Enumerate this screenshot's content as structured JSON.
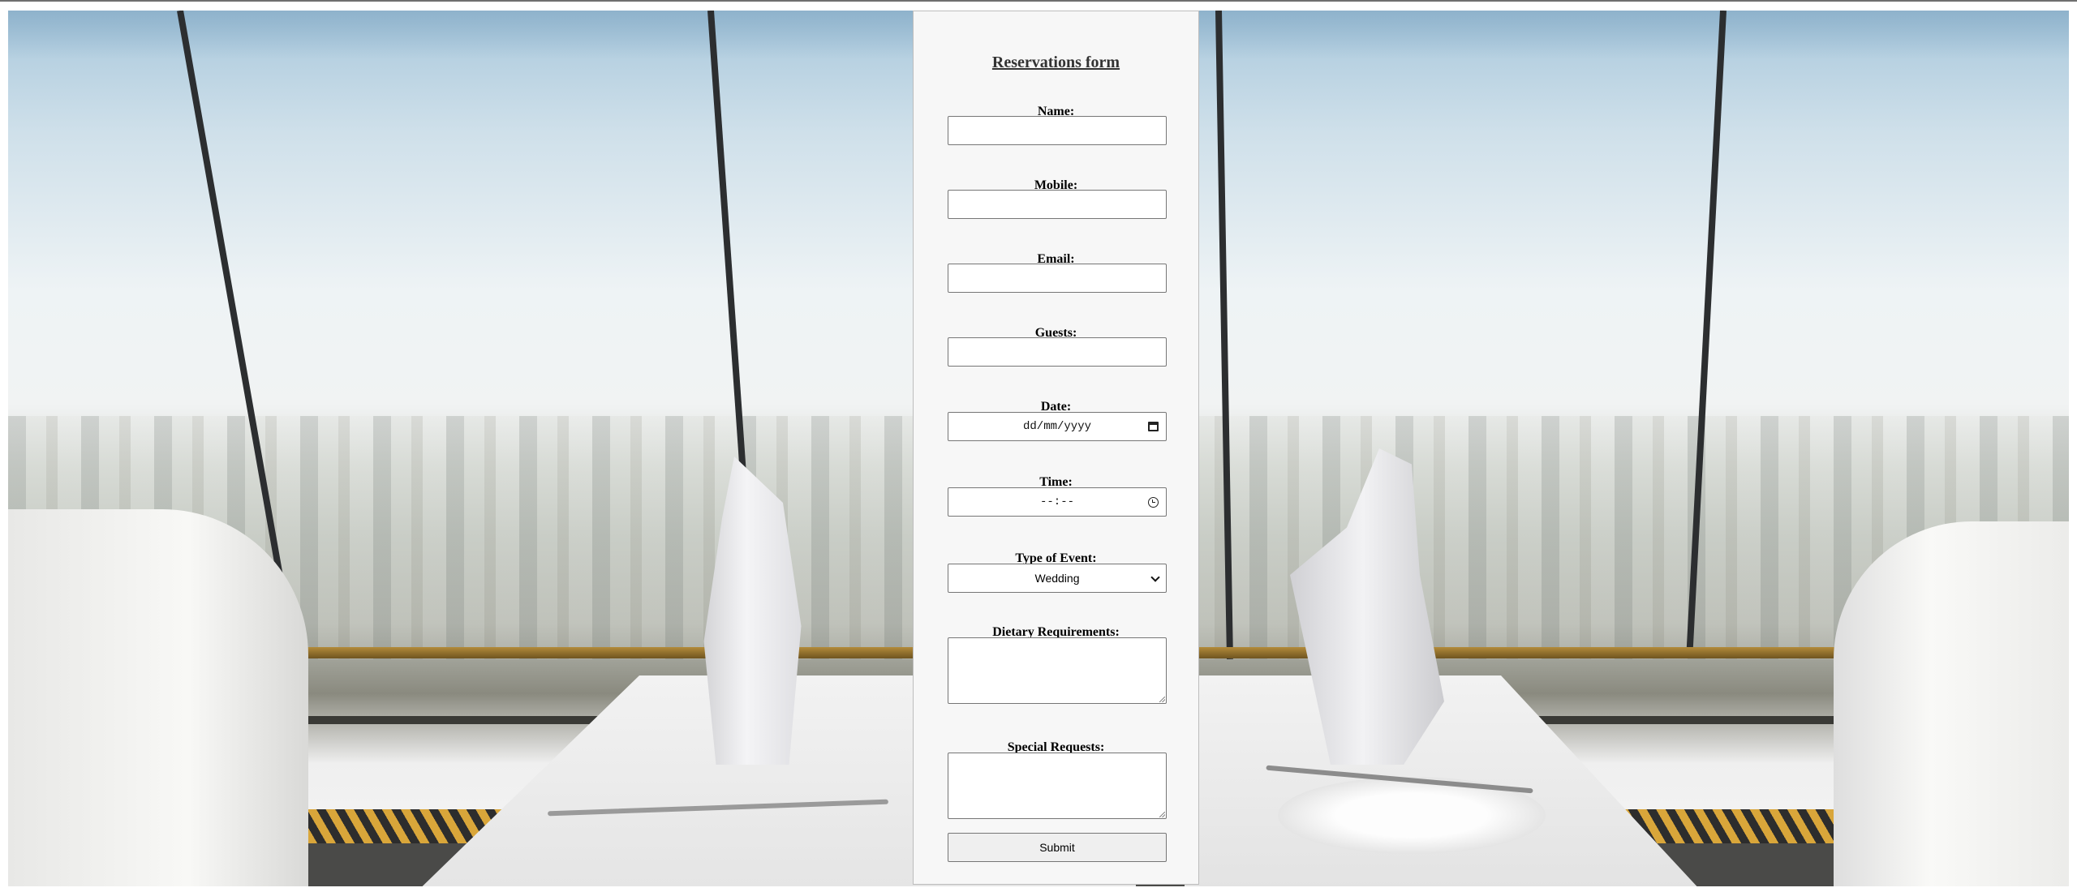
{
  "form": {
    "title": "Reservations form",
    "fields": {
      "name": {
        "label": "Name:",
        "value": ""
      },
      "mobile": {
        "label": "Mobile:",
        "value": ""
      },
      "email": {
        "label": "Email:",
        "value": ""
      },
      "guests": {
        "label": "Guests:",
        "value": ""
      },
      "date": {
        "label": "Date:",
        "placeholder": "dd/mm/yyyy"
      },
      "time": {
        "label": "Time:",
        "placeholder": "--:--"
      },
      "event_type": {
        "label": "Type of Event:",
        "selected": "Wedding"
      },
      "dietary": {
        "label": "Dietary Requirements:",
        "value": ""
      },
      "special": {
        "label": "Special Requests:",
        "value": ""
      }
    },
    "submit_label": "Submit"
  },
  "icons": {
    "date_picker": "calendar-icon",
    "time_picker": "clock-icon",
    "select": "chevron-down-icon"
  },
  "colors": {
    "panel_bg": "#f7f7f7",
    "title_text": "#333333",
    "field_border": "#767676",
    "button_bg": "#efefef"
  }
}
